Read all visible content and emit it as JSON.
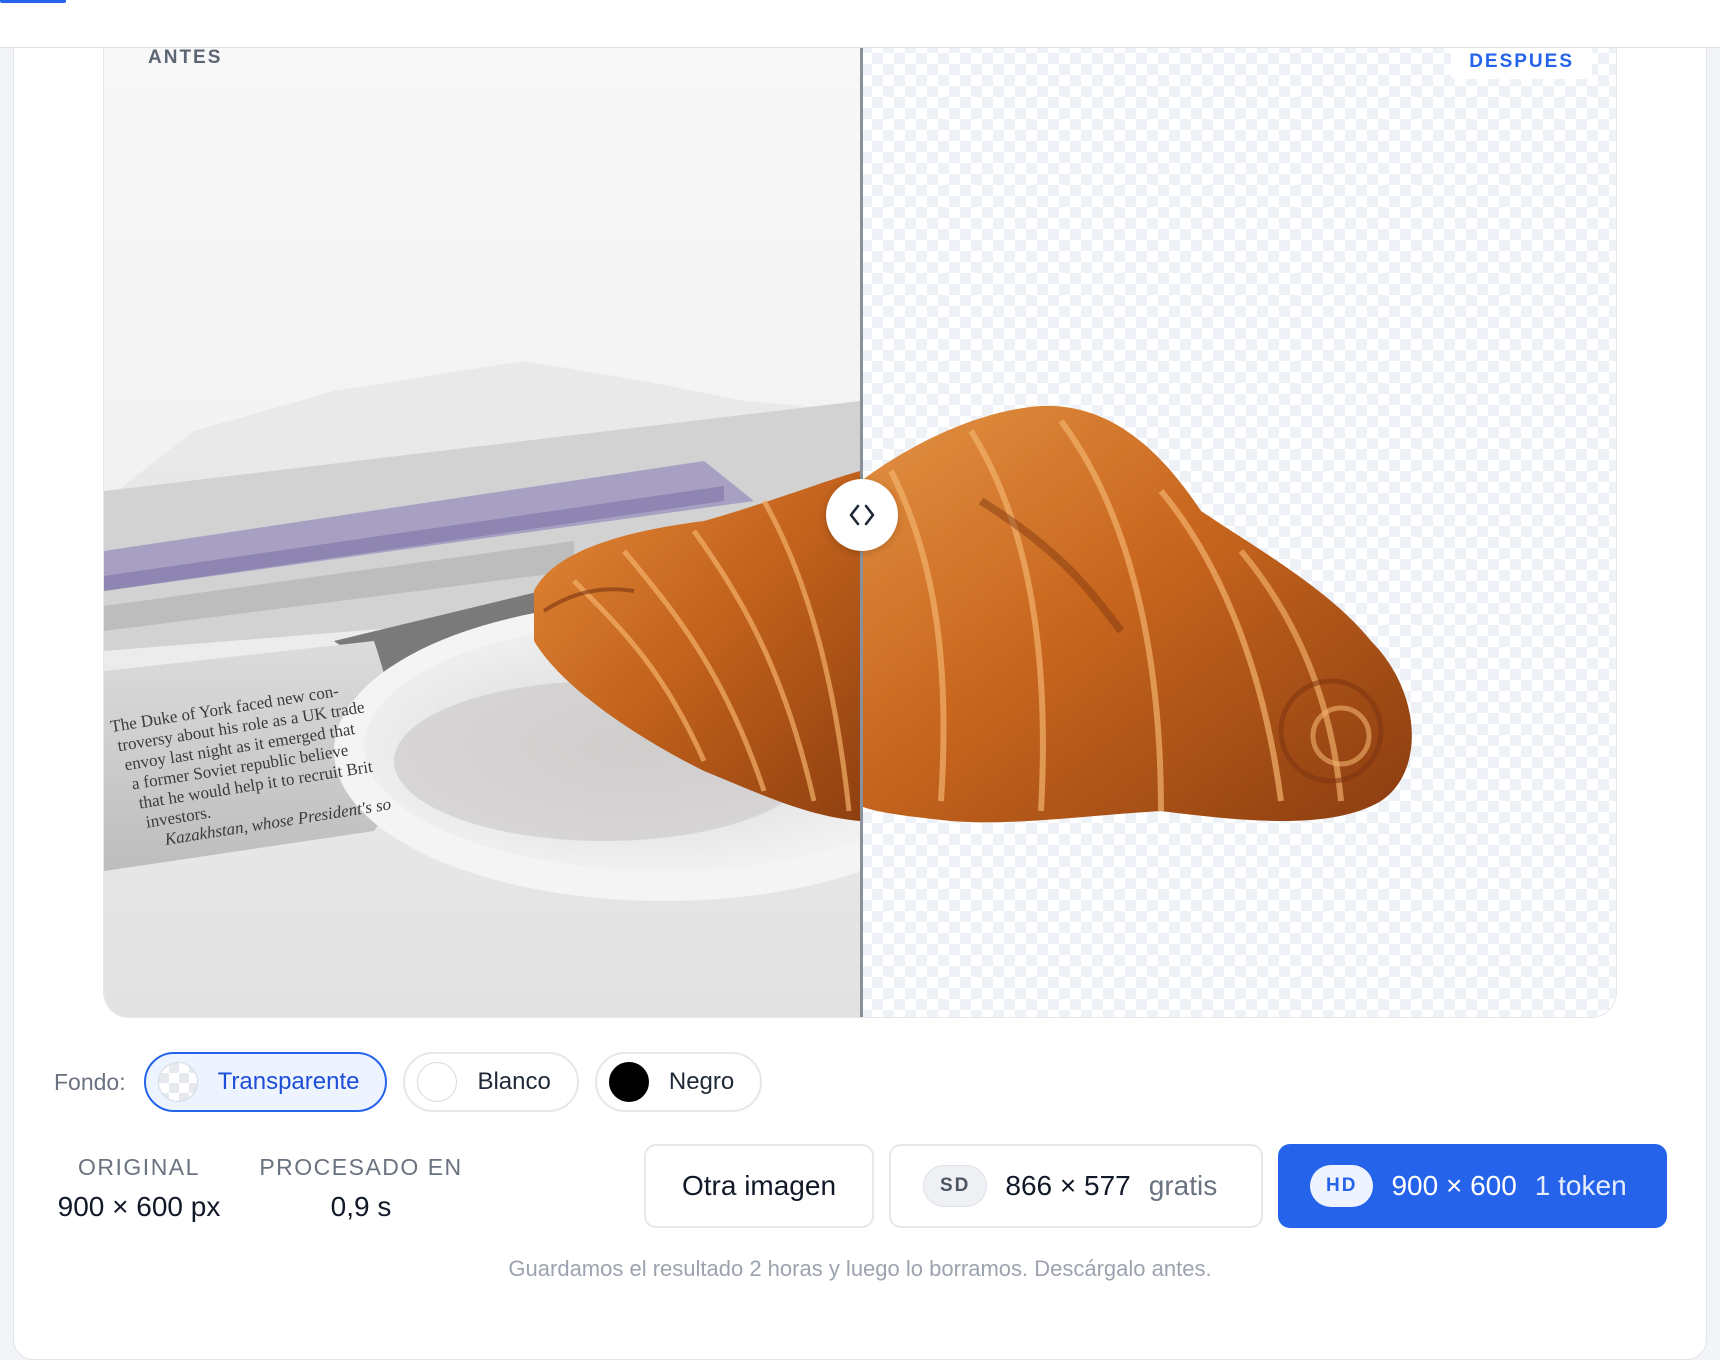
{
  "compare": {
    "before_label": "ANTES",
    "after_label": "DESPUES",
    "newspaper_lines": [
      "The Duke of York faced new con-",
      "troversy about his role as a UK trade",
      "envoy last night as it emerged that",
      "a former Soviet republic believe",
      "that he would help it to recruit Brit",
      "investors.",
      "Kazakhstan, whose President's so"
    ],
    "handle_icon": "chevron-left-right-icon"
  },
  "background": {
    "label": "Fondo:",
    "options": [
      {
        "label": "Transparente",
        "swatch": "checkerboard",
        "selected": true
      },
      {
        "label": "Blanco",
        "swatch": "#ffffff",
        "selected": false
      },
      {
        "label": "Negro",
        "swatch": "#000000",
        "selected": false
      }
    ]
  },
  "stats": {
    "original_label": "ORIGINAL",
    "original_value": "900 × 600 px",
    "processed_label": "PROCESADO EN",
    "processed_value": "0,9 s"
  },
  "actions": {
    "other_image": "Otra imagen",
    "sd": {
      "tag": "SD",
      "size": "866 × 577",
      "price": "gratis"
    },
    "hd": {
      "tag": "HD",
      "size": "900 × 600",
      "price": "1 token"
    }
  },
  "footer_note": "Guardamos el resultado 2 horas y luego lo borramos. Descárgalo antes.",
  "colors": {
    "accent": "#2563eb",
    "selected_bg": "#eef4ff",
    "croissant": "#c8661e"
  }
}
